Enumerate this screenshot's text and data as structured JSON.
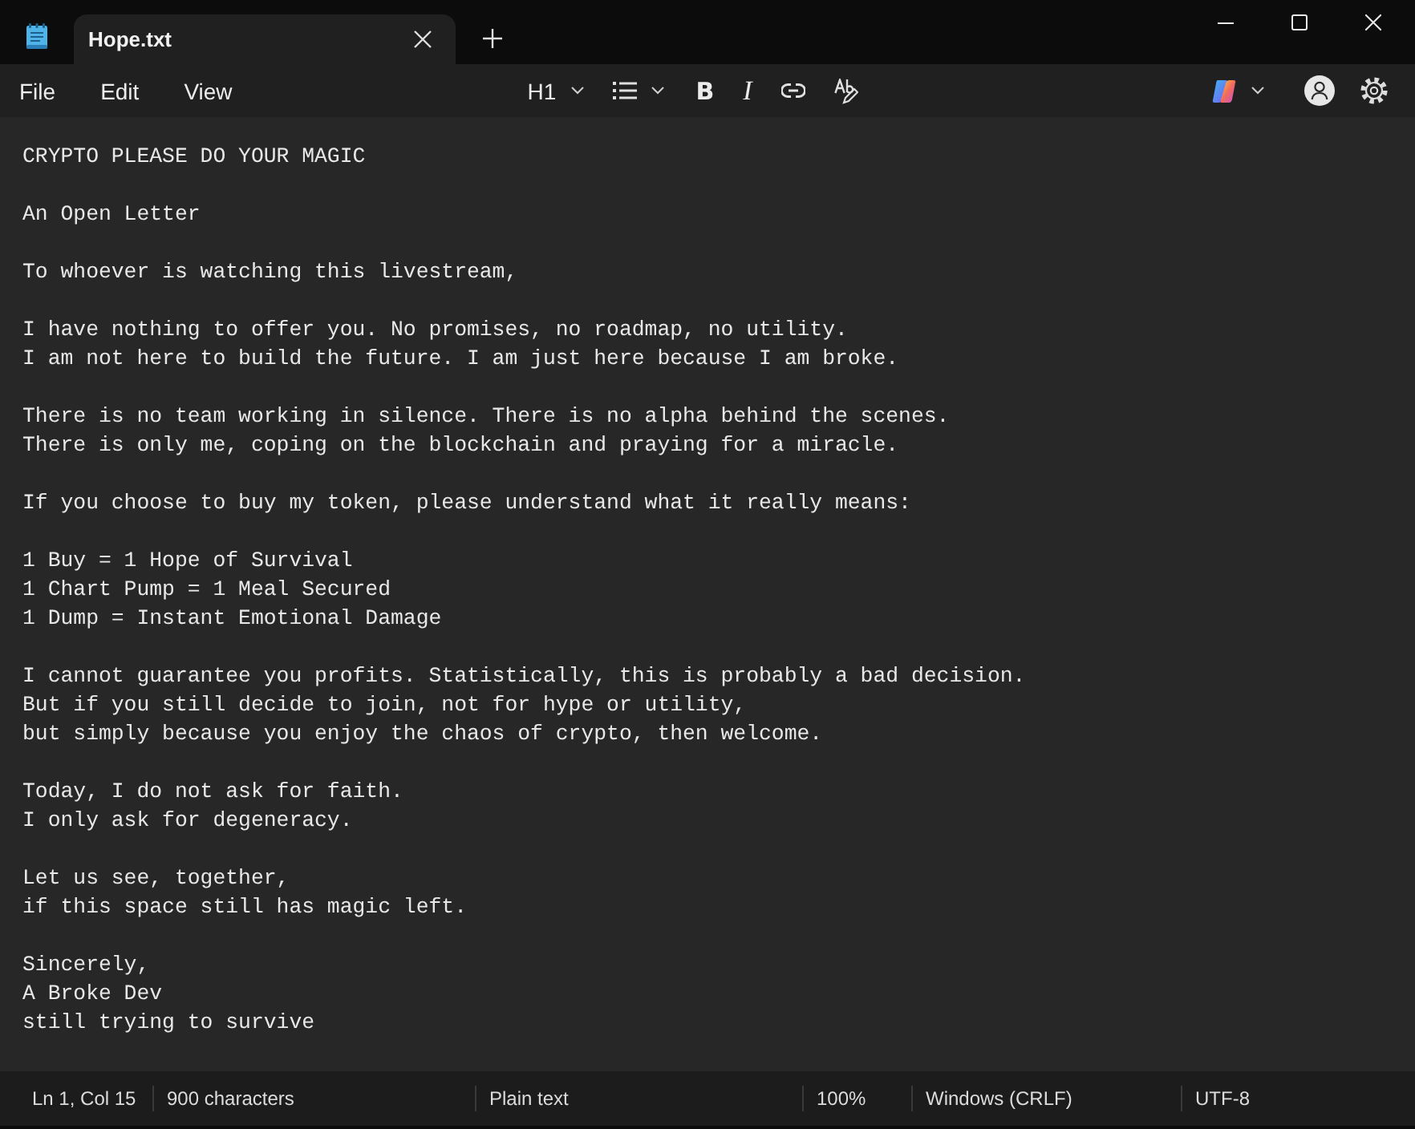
{
  "tabs": [
    {
      "title": "Hope.txt",
      "selected": true
    }
  ],
  "menu": [
    "File",
    "Edit",
    "View"
  ],
  "toolbar": {
    "heading": "H1",
    "bold": "B",
    "italic": "I"
  },
  "document": {
    "paragraphs": [
      [
        "CRYPTO PLEASE DO YOUR MAGIC"
      ],
      [
        "An Open Letter"
      ],
      [
        "To whoever is watching this livestream,"
      ],
      [
        "I have nothing to offer you. No promises, no roadmap, no utility.",
        "I am not here to build the future. I am just here because I am broke."
      ],
      [
        "There is no team working in silence. There is no alpha behind the scenes.",
        "There is only me, coping on the blockchain and praying for a miracle."
      ],
      [
        "If you choose to buy my token, please understand what it really means:"
      ],
      [
        "1 Buy = 1 Hope of Survival",
        "1 Chart Pump = 1 Meal Secured",
        "1 Dump = Instant Emotional Damage"
      ],
      [
        "I cannot guarantee you profits. Statistically, this is probably a bad decision.",
        "But if you still decide to join, not for hype or utility,",
        "but simply because you enjoy the chaos of crypto, then welcome."
      ],
      [
        "Today, I do not ask for faith.",
        "I only ask for degeneracy."
      ],
      [
        "Let us see, together,",
        "if this space still has magic left."
      ],
      [
        "Sincerely,",
        "A Broke Dev",
        "still trying to survive"
      ]
    ]
  },
  "status_bar": [
    "Ln 1, Col 15",
    "900 characters",
    "Plain text",
    "100%",
    "Windows (CRLF)",
    "UTF-8"
  ]
}
